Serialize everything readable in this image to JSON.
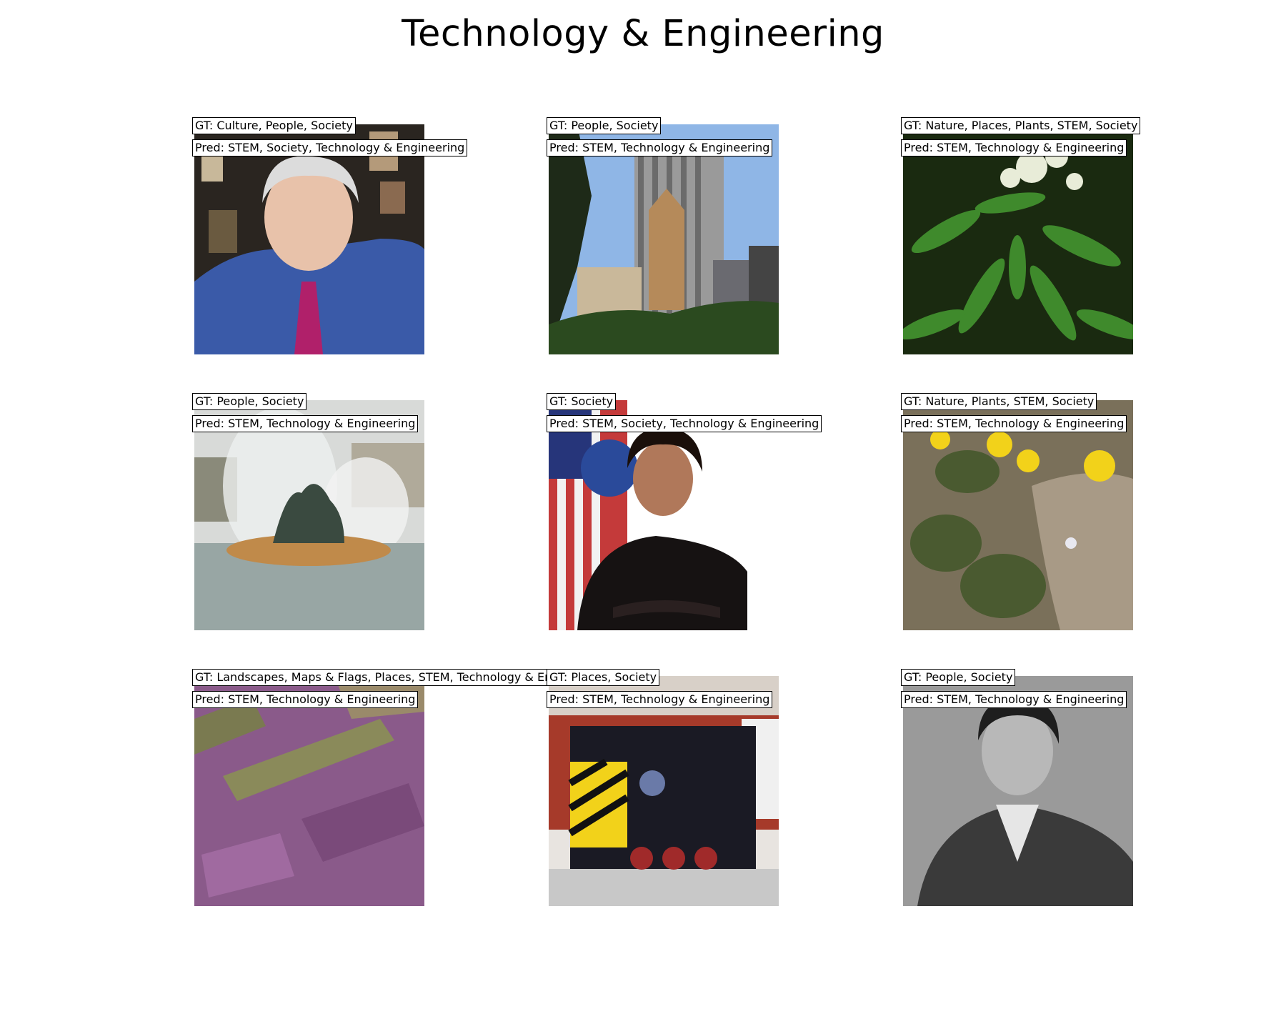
{
  "title": "Technology & Engineering",
  "panels": [
    {
      "gt": "GT: Culture, People, Society",
      "pred": "Pred: STEM, Society, Technology & Engineering",
      "image": "portrait-man-blue-shirt"
    },
    {
      "gt": "GT: People, Society",
      "pred": "Pred: STEM, Technology & Engineering",
      "image": "city-skyscrapers"
    },
    {
      "gt": "GT: Nature, Places, Plants, STEM, Society",
      "pred": "Pred: STEM, Technology & Engineering",
      "image": "white-flowering-plant"
    },
    {
      "gt": "GT: People, Society",
      "pred": "Pred: STEM, Technology & Engineering",
      "image": "fountain-sculpture"
    },
    {
      "gt": "GT: Society",
      "pred": "Pred: STEM, Society, Technology & Engineering",
      "image": "portrait-woman-flag"
    },
    {
      "gt": "GT: Nature, Plants, STEM, Society",
      "pred": "Pred: STEM, Technology & Engineering",
      "image": "yellow-wildflowers"
    },
    {
      "gt": "GT: Landscapes, Maps & Flags, Places, STEM, Technology & Engineering",
      "pred": "Pred: STEM, Technology & Engineering",
      "image": "aerial-satellite-view"
    },
    {
      "gt": "GT: Places, Society",
      "pred": "Pred: STEM, Technology & Engineering",
      "image": "locomotive-shed"
    },
    {
      "gt": "GT: People, Society",
      "pred": "Pred: STEM, Technology & Engineering",
      "image": "bw-portrait-man-suit"
    }
  ]
}
